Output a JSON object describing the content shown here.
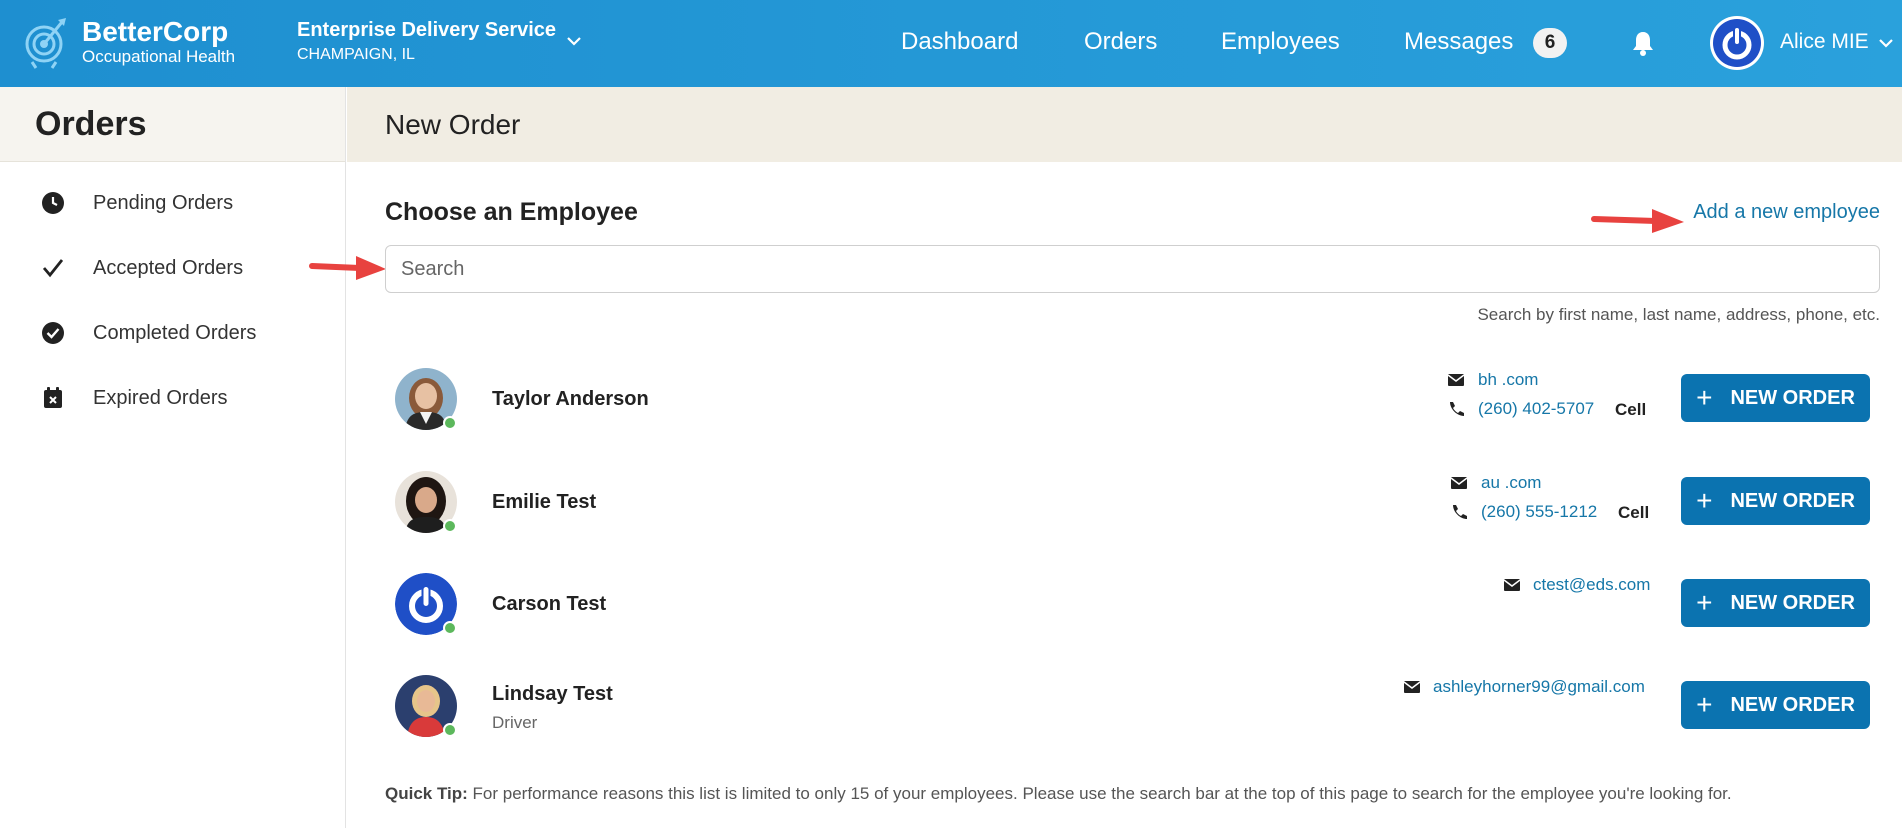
{
  "brand": {
    "name": "BetterCorp",
    "subtitle": "Occupational Health"
  },
  "org": {
    "name": "Enterprise Delivery Service",
    "location": "CHAMPAIGN, IL"
  },
  "nav": {
    "dashboard": "Dashboard",
    "orders": "Orders",
    "employees": "Employees",
    "messages": "Messages",
    "messages_count": "6"
  },
  "user": {
    "name": "Alice MIE"
  },
  "sidebar": {
    "title": "Orders",
    "items": [
      {
        "label": "Pending Orders",
        "icon": "clock-icon"
      },
      {
        "label": "Accepted Orders",
        "icon": "checkmark-icon"
      },
      {
        "label": "Completed Orders",
        "icon": "check-circle-icon"
      },
      {
        "label": "Expired Orders",
        "icon": "calendar-x-icon"
      }
    ]
  },
  "main": {
    "title": "New Order",
    "section_title": "Choose an Employee",
    "add_link": "Add a new employee",
    "search_placeholder": "Search",
    "search_help": "Search by first name, last name, address, phone, etc.",
    "new_order_label": "NEW ORDER",
    "quick_tip_label": "Quick Tip:",
    "quick_tip_text": "For performance reasons this list is limited to only 15 of your employees. Please use the search bar at the top of this page to search for the employee you're looking for."
  },
  "employees": [
    {
      "name": "Taylor Anderson",
      "role": "",
      "email": "bh                      .com",
      "phone": "(260) 402-5707",
      "phone_type": "Cell"
    },
    {
      "name": "Emilie Test",
      "role": "",
      "email": "au                      .com",
      "phone": "(260) 555-1212",
      "phone_type": "Cell"
    },
    {
      "name": "Carson Test",
      "role": "",
      "email": "ctest@eds.com",
      "phone": "",
      "phone_type": ""
    },
    {
      "name": "Lindsay Test",
      "role": "Driver",
      "email": "ashleyhorner99@gmail.com",
      "phone": "",
      "phone_type": ""
    }
  ],
  "colors": {
    "topbar": "#1e8fd0",
    "accent": "#0b73b0",
    "link": "#1677a8",
    "online": "#5cb85c",
    "annotation_arrow": "#e8423f"
  }
}
